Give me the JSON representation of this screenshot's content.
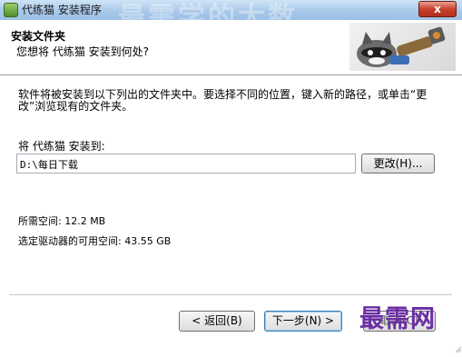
{
  "window": {
    "title": "代练猫 安装程序",
    "title_watermark": "最需学的大数",
    "close_symbol": "x"
  },
  "header": {
    "title": "安装文件夹",
    "subtitle": "您想将 代练猫 安装到何处?",
    "logo_icon": "raccoon-mascot-icon"
  },
  "main": {
    "description": "软件将被安装到以下列出的文件夹中。要选择不同的位置，键入新的路径，或单击“更改”浏览现有的文件夹。",
    "install_label": "将 代练猫 安装到:",
    "path_value": "D:\\每日下载",
    "change_button": "更改(H)...",
    "space_required": "所需空间: 12.2 MB",
    "space_available": "选定驱动器的可用空间: 43.55 GB"
  },
  "footer": {
    "back_button": "< 返回(B)",
    "next_button": "下一步(N) >",
    "cancel_button": "取消(C)"
  },
  "watermark": {
    "brand": "最需网",
    "color": "#6a2ea3"
  },
  "colors": {
    "titlebar": "#a9c9ea",
    "close": "#c7402c",
    "default_button_border": "#3c7fb1"
  }
}
